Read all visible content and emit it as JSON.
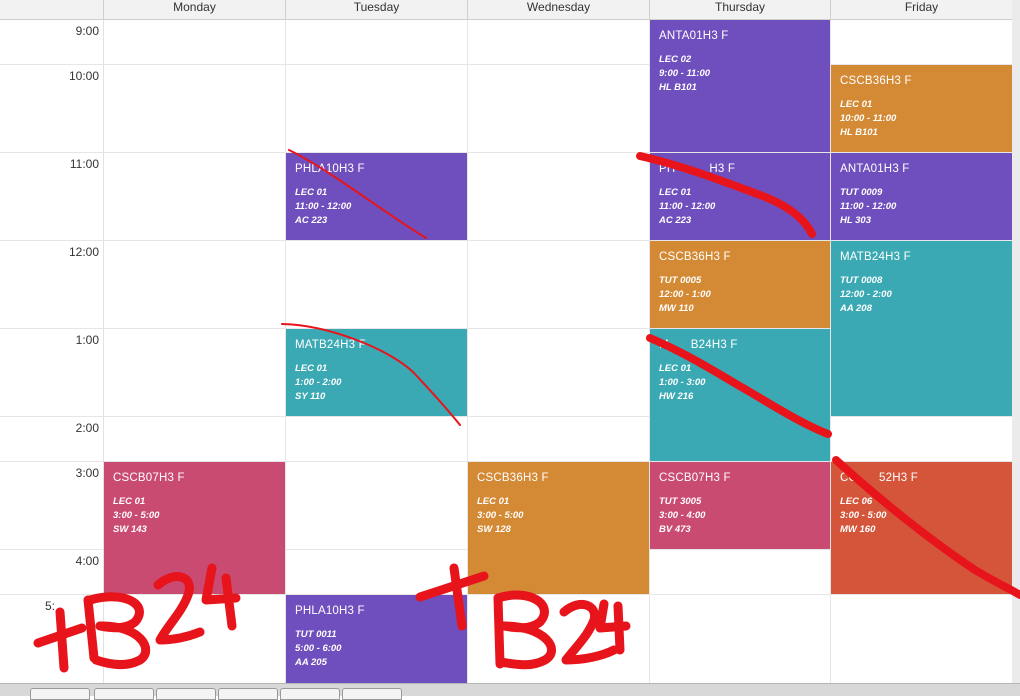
{
  "days": [
    "Monday",
    "Tuesday",
    "Wednesday",
    "Thursday",
    "Friday"
  ],
  "times": [
    "9:00",
    "10:00",
    "11:00",
    "12:00",
    "1:00",
    "2:00",
    "3:00",
    "4:00",
    "5:"
  ],
  "events": [
    {
      "code": "ANTA01H3 F",
      "section": "LEC 02",
      "time": "9:00 - 11:00",
      "room": "HL B101",
      "color": "#6f4fbd"
    },
    {
      "code": "CSCB36H3 F",
      "section": "LEC 01",
      "time": "10:00 - 11:00",
      "room": "HL B101",
      "color": "#d48a35"
    },
    {
      "code": "PHLA10H3 F",
      "section": "LEC 01",
      "time": "11:00 - 12:00",
      "room": "AC 223",
      "color": "#6f4fbd"
    },
    {
      "code": "PH",
      "code_suffix": "H3 F",
      "section": "LEC 01",
      "time": "11:00 - 12:00",
      "room": "AC 223",
      "color": "#6f4fbd"
    },
    {
      "code": "ANTA01H3 F",
      "section": "TUT 0009",
      "time": "11:00 - 12:00",
      "room": "HL 303",
      "color": "#6f4fbd"
    },
    {
      "code": "CSCB36H3 F",
      "section": "TUT 0005",
      "time": "12:00 - 1:00",
      "room": "MW 110",
      "color": "#d48a35"
    },
    {
      "code": "MATB24H3 F",
      "section": "TUT 0008",
      "time": "12:00 - 2:00",
      "room": "AA 208",
      "color": "#3aa9b4"
    },
    {
      "code": "MATB24H3 F",
      "section": "LEC 01",
      "time": "1:00 - 2:00",
      "room": "SY 110",
      "color": "#3aa9b4"
    },
    {
      "code": "M",
      "code_suffix": "B24H3 F",
      "section": "LEC 01",
      "time": "1:00 - 3:00",
      "room": "HW 216",
      "color": "#3aa9b4"
    },
    {
      "code": "CSCB07H3 F",
      "section": "LEC 01",
      "time": "3:00 - 5:00",
      "room": "SW 143",
      "color": "#c94b72"
    },
    {
      "code": "CSCB36H3 F",
      "section": "LEC 01",
      "time": "3:00 - 5:00",
      "room": "SW 128",
      "color": "#d48a35"
    },
    {
      "code": "CSCB07H3 F",
      "section": "TUT 3005",
      "time": "3:00 - 4:00",
      "room": "BV 473",
      "color": "#c94b72"
    },
    {
      "code": "CC",
      "code_suffix": "52H3 F",
      "section": "LEC 06",
      "time": "3:00 - 5:00",
      "room": "MW 160",
      "color": "#d4553a"
    },
    {
      "code": "PHLA10H3 F",
      "section": "TUT 0011",
      "time": "5:00 - 6:00",
      "room": "AA 205",
      "color": "#6f4fbd"
    }
  ],
  "annotations": {
    "left_note": "+B24",
    "right_note": "+B24",
    "ink_color": "#e8141b"
  }
}
